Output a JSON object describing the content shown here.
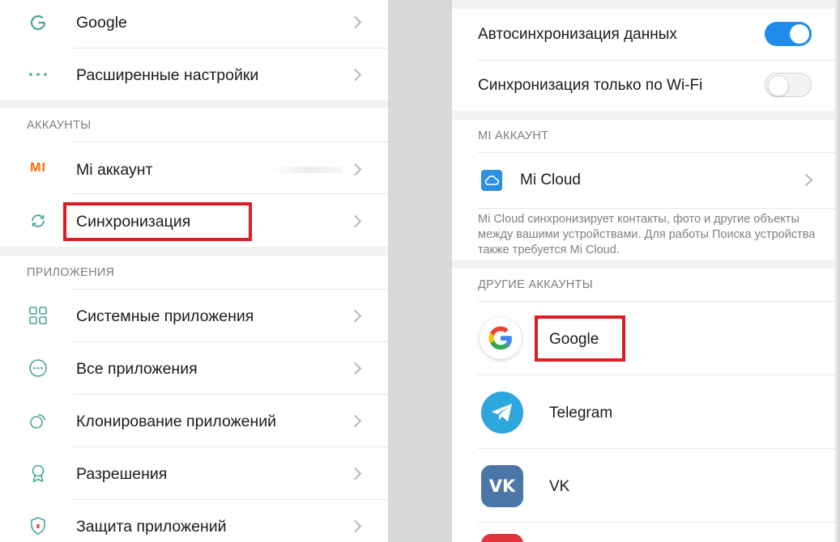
{
  "left": {
    "items_top": [
      {
        "label": "Google",
        "icon": "google-g-icon"
      },
      {
        "label": "Расширенные настройки",
        "icon": "more-dots-icon"
      }
    ],
    "accounts_section": {
      "title": "АККАУНТЫ",
      "items": [
        {
          "label": "Mi аккаунт",
          "icon": "mi-logo-icon",
          "icon_text": "MI"
        },
        {
          "label": "Синхронизация",
          "icon": "sync-icon"
        }
      ]
    },
    "apps_section": {
      "title": "ПРИЛОЖЕНИЯ",
      "items": [
        {
          "label": "Системные приложения",
          "icon": "grid-apps-icon"
        },
        {
          "label": "Все приложения",
          "icon": "all-apps-icon"
        },
        {
          "label": "Клонирование приложений",
          "icon": "clone-icon"
        },
        {
          "label": "Разрешения",
          "icon": "permissions-badge-icon"
        },
        {
          "label": "Защита приложений",
          "icon": "shield-lock-icon"
        }
      ]
    }
  },
  "right": {
    "autosync": {
      "label": "Автосинхронизация данных",
      "enabled": true
    },
    "wifi_only": {
      "label": "Синхронизация только по Wi-Fi",
      "enabled": false
    },
    "mi_account_section": {
      "title": "MI АККАУНТ",
      "mi_cloud_label": "Mi Cloud",
      "mi_cloud_icon": "cloud-icon",
      "description": "Mi Cloud синхронизирует контакты, фото и другие объекты между вашими устройствами. Для работы Поиска устройства также требуется Mi Cloud."
    },
    "other_accounts_section": {
      "title": "ДРУГИЕ АККАУНТЫ",
      "accounts": [
        {
          "label": "Google",
          "icon": "google-logo-icon"
        },
        {
          "label": "Telegram",
          "icon": "telegram-icon"
        },
        {
          "label": "VK",
          "icon": "vk-icon",
          "icon_text": "VK"
        }
      ]
    }
  },
  "colors": {
    "highlight_red": "#de1c24",
    "toggle_on": "#1f8bea",
    "mi_orange": "#ff6900",
    "telegram_blue": "#2ea6de",
    "vk_blue": "#4a76a8",
    "icon_teal": "#4aa59a"
  }
}
